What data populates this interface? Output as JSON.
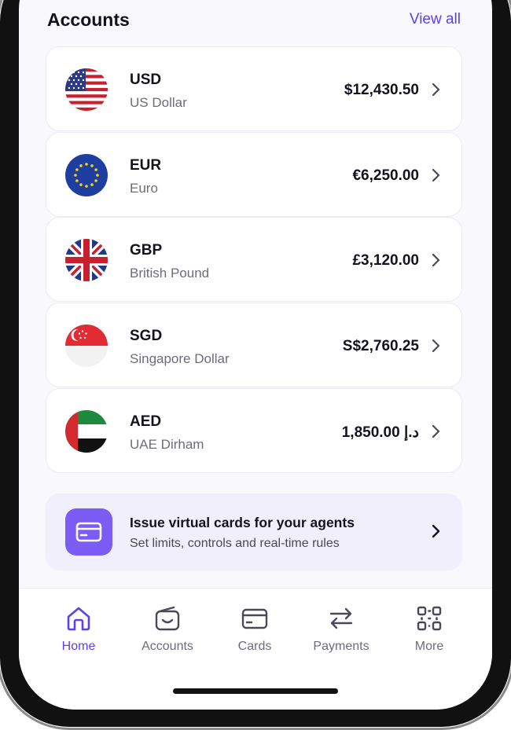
{
  "accounts_section": {
    "title": "Accounts",
    "view_all_label": "View all",
    "items": [
      {
        "code": "USD",
        "name": "US Dollar",
        "amount": "$12,430.50",
        "flag": "us-flag-icon"
      },
      {
        "code": "EUR",
        "name": "Euro",
        "amount": "€6,250.00",
        "flag": "eu-flag-icon"
      },
      {
        "code": "GBP",
        "name": "British Pound",
        "amount": "£3,120.00",
        "flag": "uk-flag-icon"
      },
      {
        "code": "SGD",
        "name": "Singapore Dollar",
        "amount": "S$2,760.25",
        "flag": "sg-flag-icon"
      },
      {
        "code": "AED",
        "name": "UAE Dirham",
        "amount": "د.إ 1,850.00",
        "flag": "ae-flag-icon"
      }
    ]
  },
  "promo": {
    "title": "Issue virtual cards for your agents",
    "subtitle": "Set limits, controls and real-time rules",
    "icon": "card-icon"
  },
  "tab_bar": {
    "items": [
      {
        "label": "Home",
        "icon": "home-icon",
        "active": true
      },
      {
        "label": "Accounts",
        "icon": "wallet-icon",
        "active": false
      },
      {
        "label": "Cards",
        "icon": "card-icon",
        "active": false
      },
      {
        "label": "Payments",
        "icon": "transfer-arrows-icon",
        "active": false
      },
      {
        "label": "More",
        "icon": "grid-icon",
        "active": false
      }
    ]
  },
  "colors": {
    "accent": "#5b3ff0",
    "promo_tile": "#7b5cf5",
    "promo_background": "#f1effb",
    "text_primary": "#14121f",
    "text_secondary": "#6e6c7c"
  }
}
